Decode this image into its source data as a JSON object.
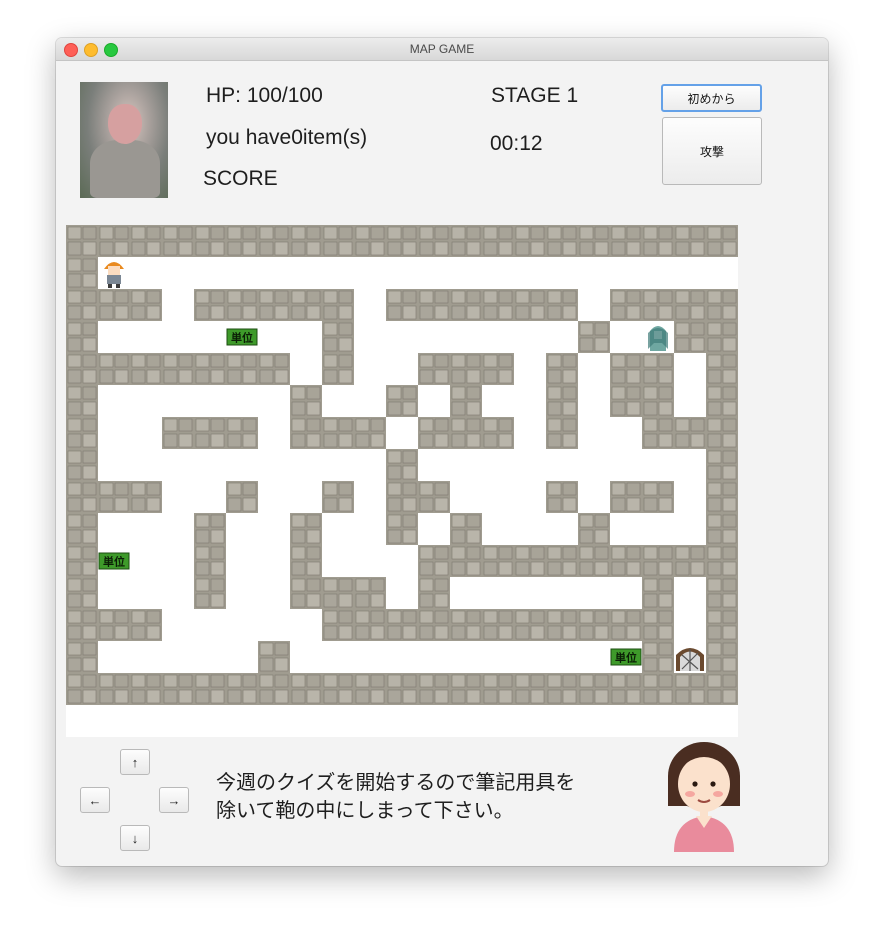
{
  "window": {
    "title": "MAP GAME"
  },
  "status": {
    "hp": "HP: 100/100",
    "items": "you have0item(s)",
    "score": "SCORE",
    "stage": "STAGE 1",
    "time": "00:12"
  },
  "buttons": {
    "restart": "初めから",
    "attack": "攻撃"
  },
  "controls": {
    "up": "↑",
    "left": "←",
    "right": "→",
    "down": "↓"
  },
  "message": {
    "line1": "今週のクイズを開始するので筆記用具を",
    "line2": "除いて鞄の中にしまって下さい。"
  },
  "map": {
    "rows": [
      "#####################",
      "#.....................#",
      "###.#####.######.##",
      "#.......#.......#..#",
      "#######.#..###.#.##.#",
      "#......#..#.#..#.##.#",
      "#..###.###.###.#..###",
      "#.........#.........#",
      "###..#..#.##...#.##.#",
      "#...#..#..#.#...#...#",
      "#...#..#...##########",
      "#...#..###.#......#.#",
      "###.....###########.#",
      "#.....#...........#.#",
      "#####################"
    ],
    "item_label": "単位",
    "items": [
      [
        5,
        3
      ],
      [
        1,
        10
      ],
      [
        17,
        13
      ]
    ],
    "player": [
      1,
      1
    ],
    "enemy": [
      18,
      3
    ],
    "goal": [
      19,
      13
    ]
  },
  "colors": {
    "wall": "#a09c90",
    "floor": "#ffffff",
    "item": "#3e9a2a"
  }
}
